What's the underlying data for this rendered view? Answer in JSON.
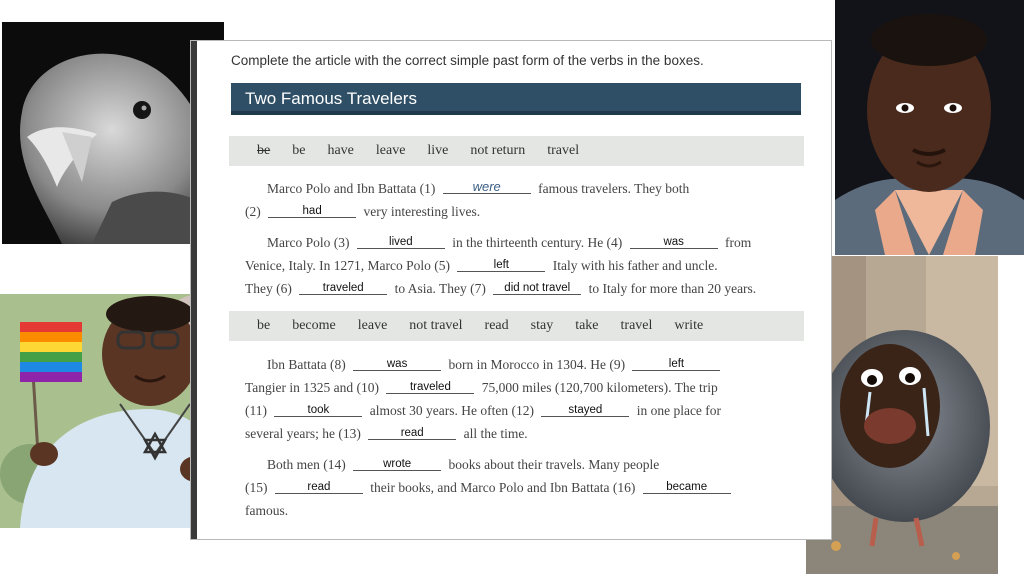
{
  "instructions": "Complete the article with the correct simple past form of the verbs in the boxes.",
  "title": "Two Famous Travelers",
  "box1_words": [
    "be",
    "be",
    "have",
    "leave",
    "live",
    "not return",
    "travel"
  ],
  "box2_words": [
    "be",
    "become",
    "leave",
    "not travel",
    "read",
    "stay",
    "take",
    "travel",
    "write"
  ],
  "text": {
    "p1l1a": "Marco Polo and Ibn Battata (1)",
    "p1l1b": "famous travelers. They both",
    "p1l2a": "(2)",
    "p1l2b": "very interesting lives.",
    "p2l1a": "Marco Polo (3)",
    "p2l1b": "in the thirteenth century. He (4)",
    "p2l1c": "from",
    "p2l2a": "Venice, Italy. In 1271, Marco Polo (5)",
    "p2l2b": "Italy with his father and uncle.",
    "p2l3a": "They (6)",
    "p2l3b": "to Asia. They (7)",
    "p2l3c": "to Italy for more than 20 years.",
    "p3l1a": "Ibn Battata (8)",
    "p3l1b": "born in Morocco in 1304. He (9)",
    "p3l2a": "Tangier in 1325 and (10)",
    "p3l2b": "75,000 miles (120,700 kilometers). The trip",
    "p3l3a": "(11)",
    "p3l3b": "almost 30 years. He often (12)",
    "p3l3c": "in one place for",
    "p3l4a": "several years; he (13)",
    "p3l4b": "all the time.",
    "p4l1a": "Both men (14)",
    "p4l1b": "books about their travels. Many people",
    "p4l2a": "(15)",
    "p4l2b": "their books, and Marco Polo and Ibn Battata (16)",
    "p4l3": "famous."
  },
  "answers": {
    "a1": "were",
    "a2": "had",
    "a3": "lived",
    "a4": "was",
    "a5": "left",
    "a6": "traveled",
    "a7": "did not travel",
    "a8": "was",
    "a9": "left",
    "a10": "traveled",
    "a11": "took",
    "a12": "stayed",
    "a13": "read",
    "a14": "wrote",
    "a15": "read",
    "a16": "became"
  },
  "colors": {
    "title_bar": "#2f4f66",
    "word_box": "#e4e6e4",
    "handwritten_answer": "#3b5e84"
  }
}
